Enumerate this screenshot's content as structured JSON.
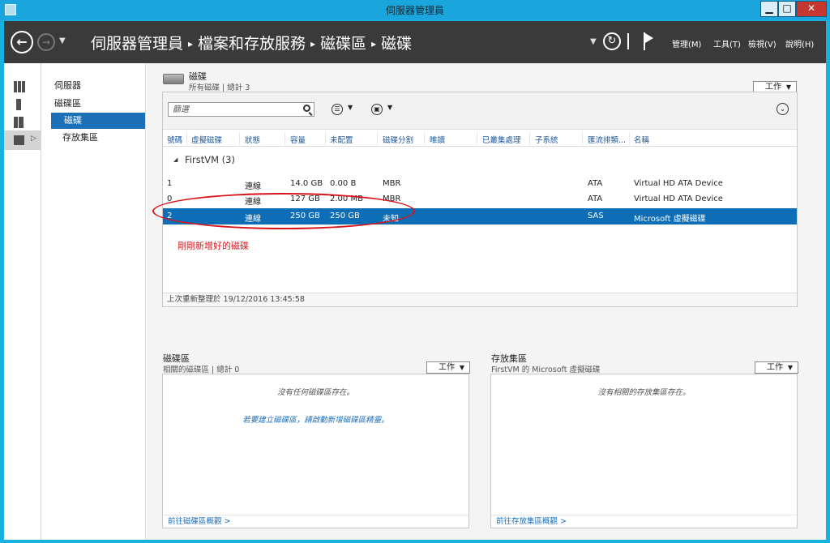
{
  "window": {
    "title": "伺服器管理員"
  },
  "window_controls": {
    "minimize": "▁",
    "maximize": "□",
    "close": "✕"
  },
  "header": {
    "breadcrumb": [
      "伺服器管理員",
      "檔案和存放服務",
      "磁碟區",
      "磁碟"
    ],
    "separator": "▸",
    "refresh_icon": "↻",
    "menus": {
      "manage": "管理(M)",
      "tools": "工具(T)",
      "view": "檢視(V)",
      "help": "說明(H)"
    }
  },
  "subnav": {
    "servers": "伺服器",
    "volumes": "磁碟區",
    "disks": "磁碟",
    "pools": "存放集區"
  },
  "disks": {
    "title": "磁碟",
    "subtitle": "所有磁碟 | 總計 3",
    "tasks_label": "工作",
    "filter_placeholder": "篩選",
    "columns": [
      "號碼",
      "虛擬磁碟",
      "狀態",
      "容量",
      "未配置",
      "磁碟分割",
      "唯讀",
      "已叢集處理",
      "子系統",
      "匯流排類...",
      "名稱"
    ],
    "group": "FirstVM (3)",
    "rows": [
      {
        "number": "1",
        "virtual_disk": "",
        "status": "連線",
        "capacity": "14.0 GB",
        "unallocated": "0.00 B",
        "partition": "MBR",
        "read_only": "",
        "clustered": "",
        "subsystem": "",
        "bus_type": "ATA",
        "name": "Virtual HD ATA Device",
        "selected": false
      },
      {
        "number": "0",
        "virtual_disk": "",
        "status": "連線",
        "capacity": "127 GB",
        "unallocated": "2.00 MB",
        "partition": "MBR",
        "read_only": "",
        "clustered": "",
        "subsystem": "",
        "bus_type": "ATA",
        "name": "Virtual HD ATA Device",
        "selected": false
      },
      {
        "number": "2",
        "virtual_disk": "",
        "status": "連線",
        "capacity": "250 GB",
        "unallocated": "250 GB",
        "partition": "未知",
        "read_only": "",
        "clustered": "",
        "subsystem": "",
        "bus_type": "SAS",
        "name": "Microsoft 虛擬磁碟",
        "selected": true
      }
    ],
    "annotation": "剛剛新增好的磁碟",
    "footer": "上次重新整理於 19/12/2016 13:45:58"
  },
  "volumes_panel": {
    "title": "磁碟區",
    "subtitle": "相關的磁碟區 | 總計 0",
    "tasks_label": "工作",
    "empty_message": "沒有任何磁碟區存在。",
    "create_link": "若要建立磁碟區，請啟動新增磁碟區精靈。",
    "footer_link": "前往磁碟區概觀 >"
  },
  "pools_panel": {
    "title": "存放集區",
    "subtitle": "FirstVM 的 Microsoft 虛擬磁碟",
    "tasks_label": "工作",
    "empty_message": "沒有相關的存放集區存在。",
    "footer_link": "前往存放集區概觀 >"
  },
  "colors": {
    "accent": "#1b70b8",
    "selected_row": "#0d6db6",
    "header_bg": "#3a3a3a",
    "annotation": "#d8141b",
    "titlebar": "#1aa6dc"
  },
  "icons": [
    "server-manager-app-icon",
    "back-arrow-icon",
    "forward-arrow-icon",
    "refresh-icon",
    "flag-icon",
    "dashboard-icon",
    "local-server-icon",
    "all-servers-icon",
    "file-services-icon",
    "disk-icon",
    "search-icon",
    "list-view-icon",
    "save-query-icon",
    "collapse-icon"
  ]
}
